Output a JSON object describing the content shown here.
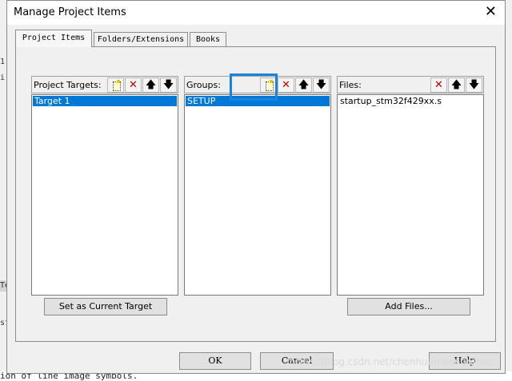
{
  "window": {
    "title": "Manage Project Items",
    "close_glyph": "✕"
  },
  "tabs": [
    {
      "label": "Project Items"
    },
    {
      "label": "Folders/Extensions"
    },
    {
      "label": "Books"
    }
  ],
  "targets": {
    "label": "Project Targets:",
    "items": [
      "Target 1"
    ],
    "selected": "Target 1"
  },
  "groups": {
    "label": "Groups:",
    "items": [
      "SETUP"
    ],
    "selected": "SETUP"
  },
  "files": {
    "label": "Files:",
    "items": [
      "startup_stm32f429xx.s"
    ]
  },
  "toolbar_icons": [
    "new-icon",
    "delete-icon",
    "move-up-icon",
    "move-down-icon"
  ],
  "glyphs": {
    "delete": "✕",
    "up": "🡅",
    "down": "🡇"
  },
  "buttons": {
    "set_current": "Set as Current Target",
    "add_files": "Add Files...",
    "ok": "OK",
    "cancel": "Cancel",
    "help": "Help"
  },
  "background": {
    "bottom_text": "ion of line image symbols.",
    "left_glyphs": [
      "1",
      "i",
      "Te",
      "st"
    ]
  },
  "watermark": "https://blog.csdn.net/chenhuanqiangnihao",
  "colors": {
    "selection": "#0078d7",
    "highlight_box": "#1a83dd",
    "delete_icon": "#c00000"
  }
}
